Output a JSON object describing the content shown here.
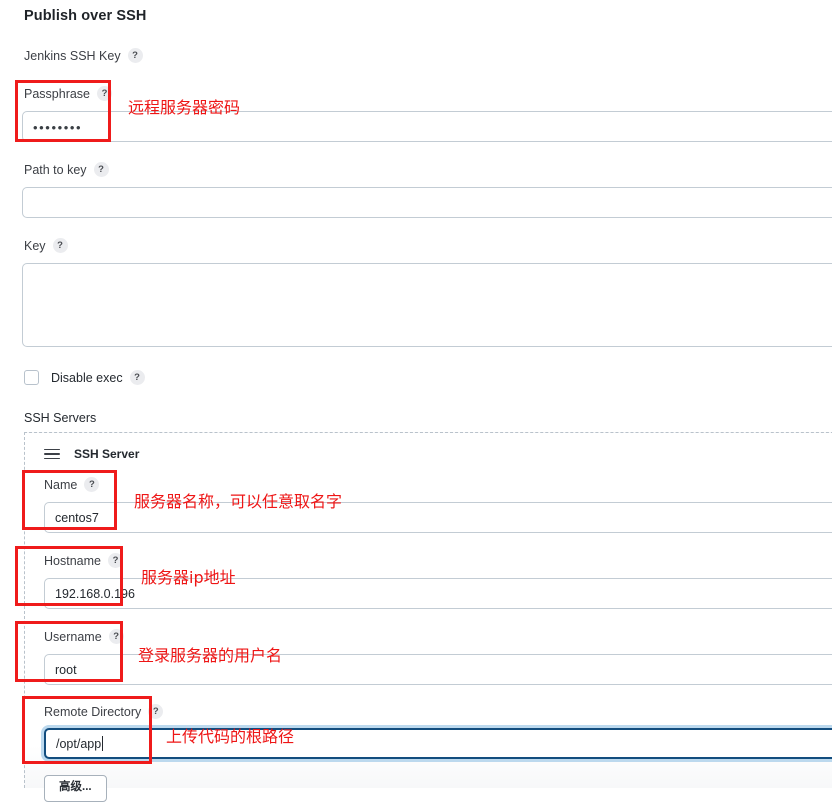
{
  "page": {
    "title": "Publish over SSH"
  },
  "icons": {
    "help": "?",
    "drag_handle": "drag-handle-icon"
  },
  "form": {
    "fields": [
      {
        "key": "jenkins_ssh_key",
        "label": "Jenkins SSH Key",
        "help": "?",
        "value": "",
        "type": "section-label"
      },
      {
        "key": "passphrase",
        "label": "Passphrase",
        "help": "?",
        "value": "••••••••",
        "type": "password"
      },
      {
        "key": "path_to_key",
        "label": "Path to key",
        "help": "?",
        "value": "",
        "type": "text"
      },
      {
        "key": "key",
        "label": "Key",
        "help": "?",
        "value": "",
        "type": "textarea"
      }
    ],
    "disable_exec": {
      "label": "Disable exec",
      "help": "?",
      "checked": false
    },
    "ssh_servers_caption": "SSH Servers"
  },
  "ssh_server": {
    "title": "SSH Server",
    "fields": [
      {
        "key": "name",
        "label": "Name",
        "help": "?",
        "value": "centos7",
        "focused": false
      },
      {
        "key": "hostname",
        "label": "Hostname",
        "help": "?",
        "value": "192.168.0.196",
        "focused": false
      },
      {
        "key": "username",
        "label": "Username",
        "help": "?",
        "value": "root",
        "focused": false
      },
      {
        "key": "remote_directory",
        "label": "Remote Directory",
        "help": "?",
        "value": "/opt/app",
        "focused": true
      }
    ],
    "advanced_button": "高级..."
  },
  "annotations": {
    "color": "#ee1515",
    "box_color": "#ef1b1b",
    "items": [
      {
        "key": "passphrase",
        "text": "远程服务器密码"
      },
      {
        "key": "name",
        "text": "服务器名称，可以任意取名字"
      },
      {
        "key": "hostname",
        "text": "服务器ip地址"
      },
      {
        "key": "username",
        "text": "登录服务器的用户名"
      },
      {
        "key": "remote_directory",
        "text": "上传代码的根路径"
      }
    ]
  }
}
